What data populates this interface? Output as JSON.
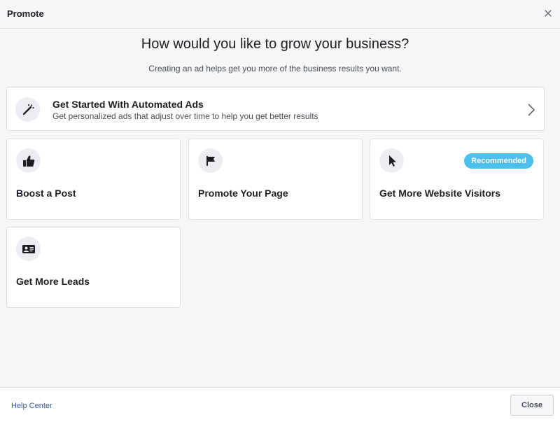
{
  "dialog": {
    "title": "Promote",
    "close_icon": "close-icon"
  },
  "main": {
    "headline": "How would you like to grow your business?",
    "subline": "Creating an ad helps get you more of the business results you want."
  },
  "automated_ads": {
    "icon": "magic-wand-icon",
    "title": "Get Started With Automated Ads",
    "description": "Get personalized ads that adjust over time to help you get better results",
    "chevron_icon": "chevron-right-icon"
  },
  "options": [
    {
      "icon": "thumbs-up-icon",
      "label": "Boost a Post"
    },
    {
      "icon": "flag-icon",
      "label": "Promote Your Page"
    },
    {
      "icon": "cursor-icon",
      "label": "Get More Website Visitors",
      "badge": "Recommended"
    },
    {
      "icon": "contact-card-icon",
      "label": "Get More Leads"
    }
  ],
  "footer": {
    "help_link": "Help Center",
    "close_label": "Close"
  },
  "colors": {
    "background": "#f5f6f7",
    "card": "#ffffff",
    "badge": "#4cc0ec",
    "link": "#385898",
    "border": "#dddfe2"
  }
}
